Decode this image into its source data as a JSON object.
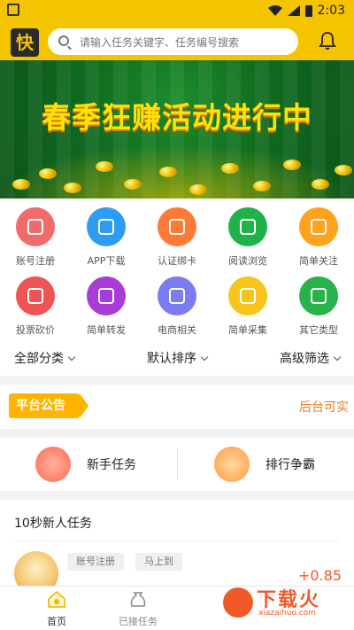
{
  "status": {
    "time": "2:03"
  },
  "header": {
    "logo_text": "快",
    "search_placeholder": "请输入任务关键字、任务编号搜索"
  },
  "banner": {
    "title": "春季狂赚活动进行中"
  },
  "grid": [
    {
      "label": "账号注册",
      "color": "#f26b6b"
    },
    {
      "label": "APP下载",
      "color": "#2f9cf3"
    },
    {
      "label": "认证绑卡",
      "color": "#ff7a36"
    },
    {
      "label": "阅读浏览",
      "color": "#20b24a"
    },
    {
      "label": "简单关注",
      "color": "#ffa21e"
    },
    {
      "label": "投票砍价",
      "color": "#ef5454"
    },
    {
      "label": "简单转发",
      "color": "#a93bd6"
    },
    {
      "label": "电商相关",
      "color": "#7a7cf0"
    },
    {
      "label": "简单采集",
      "color": "#f7c41c"
    },
    {
      "label": "其它类型",
      "color": "#27b24a"
    }
  ],
  "filters": {
    "category": "全部分类",
    "sort": "默认排序",
    "advanced": "高级筛选"
  },
  "notice": {
    "badge": "平台公告",
    "text": "后台可实"
  },
  "entries": {
    "new_task": "新手任务",
    "ranking": "排行争霸"
  },
  "tasks": {
    "section_title": "10秒新人任务",
    "tag1": "账号注册",
    "tag2": "马上到",
    "reward": "+0.85"
  },
  "tabs": {
    "home": "首页",
    "accepted": "已接任务"
  },
  "watermark": {
    "text": "下载火",
    "sub": "xiazaihuo.com"
  },
  "colors": {
    "accent": "#f5c400",
    "orange": "#f05a28"
  }
}
